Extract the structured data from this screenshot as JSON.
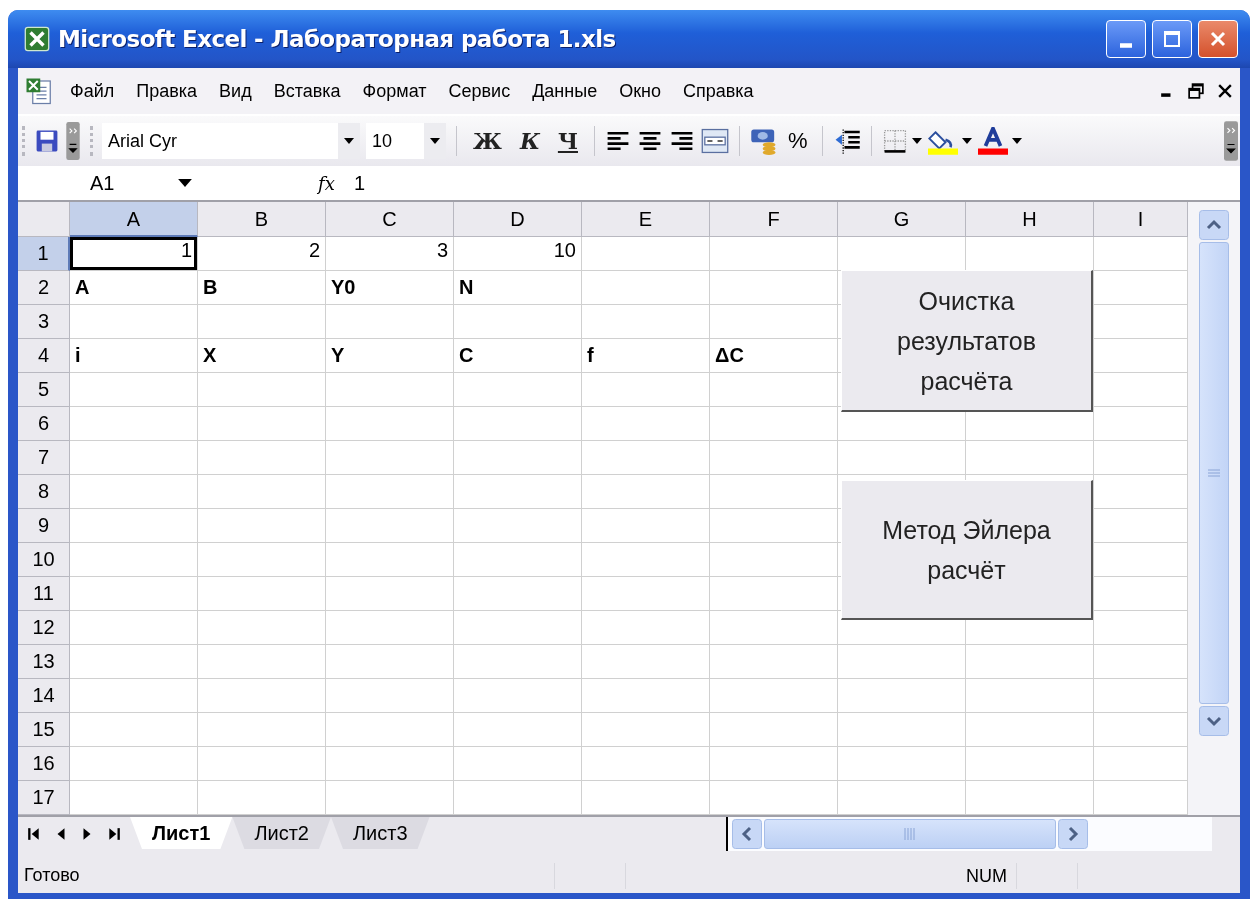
{
  "window": {
    "title": "Microsoft Excel - Лабораторная работа 1.xls"
  },
  "menu": [
    {
      "label": "Файл"
    },
    {
      "label": "Правка"
    },
    {
      "label": "Вид"
    },
    {
      "label": "Вставка"
    },
    {
      "label": "Формат"
    },
    {
      "label": "Сервис"
    },
    {
      "label": "Данные"
    },
    {
      "label": "Окно"
    },
    {
      "label": "Справка"
    }
  ],
  "toolbar": {
    "font": "Arial Cyr",
    "size": "10",
    "format_buttons": [
      {
        "label": "Ж",
        "kind": "bold"
      },
      {
        "label": "К",
        "kind": "italic"
      },
      {
        "label": "Ч",
        "kind": "underline"
      }
    ],
    "percent": "%"
  },
  "formula_bar": {
    "name_box": "A1",
    "function_label": "fx",
    "value": "1"
  },
  "sheet": {
    "columns": [
      {
        "label": "A",
        "selected": true
      },
      {
        "label": "B",
        "selected": false
      },
      {
        "label": "C",
        "selected": false
      },
      {
        "label": "D",
        "selected": false
      },
      {
        "label": "E",
        "selected": false
      },
      {
        "label": "F",
        "selected": false
      },
      {
        "label": "G",
        "selected": false
      },
      {
        "label": "H",
        "selected": false
      },
      {
        "label": "I",
        "selected": false
      }
    ],
    "rows": [
      {
        "label": "1",
        "selected": true,
        "kind": "number",
        "bold": false,
        "cells": [
          "1",
          "2",
          "3",
          "10"
        ]
      },
      {
        "label": "2",
        "selected": false,
        "kind": "text",
        "bold": true,
        "cells": [
          "A",
          "B",
          "Y0",
          "N"
        ]
      },
      {
        "label": "3",
        "selected": false,
        "kind": "text",
        "bold": false,
        "cells": []
      },
      {
        "label": "4",
        "selected": false,
        "kind": "text",
        "bold": true,
        "cells": [
          "i",
          "X",
          "Y",
          "C",
          "f",
          "ΔC"
        ]
      },
      {
        "label": "5",
        "selected": false,
        "kind": "text",
        "bold": false,
        "cells": []
      },
      {
        "label": "6",
        "selected": false,
        "kind": "text",
        "bold": false,
        "cells": []
      },
      {
        "label": "7",
        "selected": false,
        "kind": "text",
        "bold": false,
        "cells": []
      },
      {
        "label": "8",
        "selected": false,
        "kind": "text",
        "bold": false,
        "cells": []
      },
      {
        "label": "9",
        "selected": false,
        "kind": "text",
        "bold": false,
        "cells": []
      },
      {
        "label": "10",
        "selected": false,
        "kind": "text",
        "bold": false,
        "cells": []
      },
      {
        "label": "11",
        "selected": false,
        "kind": "text",
        "bold": false,
        "cells": []
      },
      {
        "label": "12",
        "selected": false,
        "kind": "text",
        "bold": false,
        "cells": []
      },
      {
        "label": "13",
        "selected": false,
        "kind": "text",
        "bold": false,
        "cells": []
      },
      {
        "label": "14",
        "selected": false,
        "kind": "text",
        "bold": false,
        "cells": []
      },
      {
        "label": "15",
        "selected": false,
        "kind": "text",
        "bold": false,
        "cells": []
      },
      {
        "label": "16",
        "selected": false,
        "kind": "text",
        "bold": false,
        "cells": []
      },
      {
        "label": "17",
        "selected": false,
        "kind": "text",
        "bold": false,
        "cells": []
      }
    ],
    "buttons": [
      {
        "lines": [
          "Очистка",
          "результатов",
          "расчёта"
        ]
      },
      {
        "lines": [
          "Метод Эйлера",
          "расчёт"
        ]
      }
    ]
  },
  "sheet_tabs": [
    {
      "label": "Лист1",
      "selected": true
    },
    {
      "label": "Лист2",
      "selected": false
    },
    {
      "label": "Лист3",
      "selected": false
    }
  ],
  "status_bar": {
    "text": "Готово",
    "indicator": "NUM"
  }
}
